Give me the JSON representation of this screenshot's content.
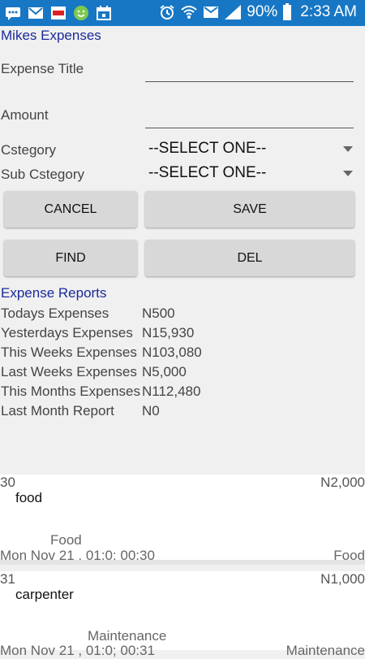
{
  "status_bar": {
    "battery": "90%",
    "time": "2:33 AM",
    "icons": [
      "chat-icon",
      "gmail-icon",
      "app-icon",
      "smiley-icon",
      "calendar-icon",
      "alarm-icon",
      "wifi-icon",
      "message-icon",
      "signal-icon",
      "battery-icon"
    ]
  },
  "app": {
    "title": "Mikes Expenses"
  },
  "form": {
    "expense_title_label": "Expense Title",
    "expense_title_value": "",
    "amount_label": "Amount",
    "amount_value": "",
    "category_label": "Cstegory",
    "category_value": "--SELECT ONE--",
    "sub_category_label": "Sub Cstegory",
    "sub_category_value": "--SELECT ONE--"
  },
  "buttons": {
    "cancel": "CANCEL",
    "save": "SAVE",
    "find": "FIND",
    "del": "DEL"
  },
  "reports": {
    "title": "Expense Reports",
    "rows": [
      {
        "label": "Todays Expenses",
        "value": "N500"
      },
      {
        "label": "Yesterdays Expenses",
        "value": "N15,930"
      },
      {
        "label": "This Weeks Expenses",
        "value": "N103,080"
      },
      {
        "label": "Last Weeks Expenses",
        "value": "N5,000"
      },
      {
        "label": "This Months Expenses",
        "value": "N112,480"
      },
      {
        "label": "Last Month Report",
        "value": "N0"
      }
    ]
  },
  "expenses": [
    {
      "day": "30",
      "amount": "N2,000",
      "title": "food",
      "category": "Food",
      "date": "Mon Nov 21 , 01:0; 00:30",
      "category2": "Food"
    },
    {
      "day": "31",
      "amount": "N1,000",
      "title": "carpenter",
      "category": "Maintenance",
      "date": "Mon Nov 21 , 01:0; 00:31",
      "category2": "Maintenance"
    }
  ],
  "colors": {
    "status_bar": "#1777c4",
    "title_blue": "#1a2a9a",
    "button_bg": "#d8d8d8",
    "background": "#f0f0f0"
  }
}
